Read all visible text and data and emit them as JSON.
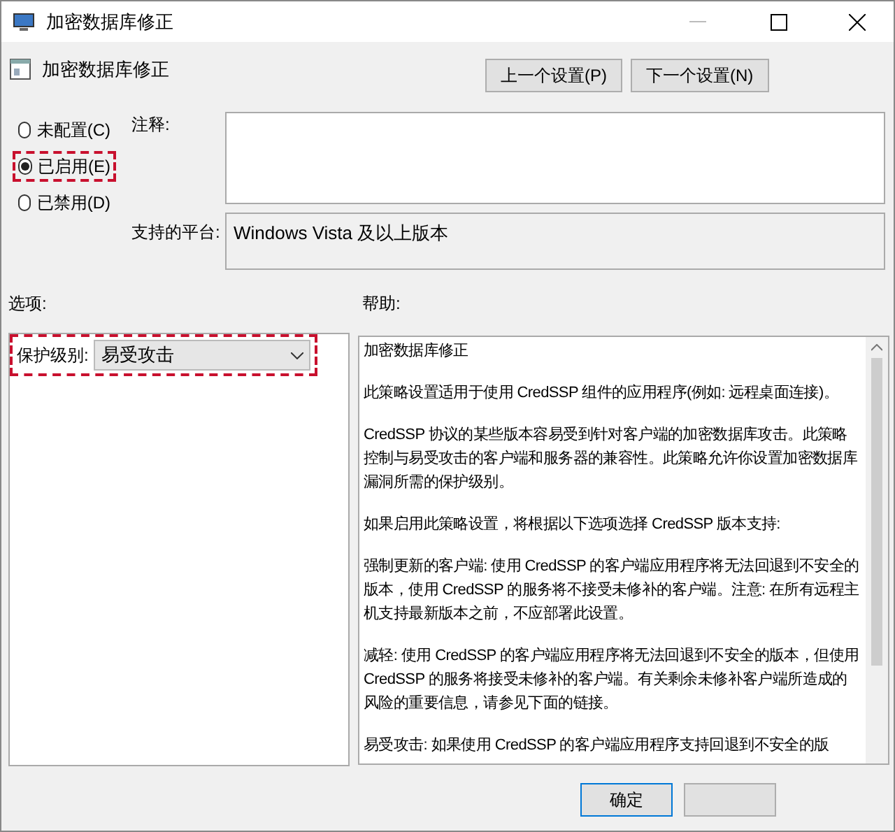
{
  "window": {
    "title": "加密数据库修正"
  },
  "header": {
    "title": "加密数据库修正",
    "buttons": [
      "上一个设置(P)",
      "下一个设置(N)"
    ]
  },
  "state_options": [
    {
      "label": "未配置(C)",
      "selected": false,
      "highlighted": false
    },
    {
      "label": "已启用(E)",
      "selected": true,
      "highlighted": true
    },
    {
      "label": "已禁用(D)",
      "selected": false,
      "highlighted": false
    }
  ],
  "comment": {
    "label": "注释:"
  },
  "platform": {
    "label": "支持的平台:",
    "value": "Windows Vista 及以上版本"
  },
  "options": {
    "heading": "选项:",
    "field_label": "保护级别:",
    "value": "易受攻击",
    "highlighted": true
  },
  "help": {
    "heading": "帮助:",
    "paragraphs": [
      "加密数据库修正",
      "此策略设置适用于使用 CredSSP 组件的应用程序(例如: 远程桌面连接)。",
      "CredSSP 协议的某些版本容易受到针对客户端的加密数据库攻击。此策略控制与易受攻击的客户端和服务器的兼容性。此策略允许你设置加密数据库漏洞所需的保护级别。",
      "如果启用此策略设置，将根据以下选项选择 CredSSP 版本支持:",
      "强制更新的客户端: 使用 CredSSP 的客户端应用程序将无法回退到不安全的版本，使用 CredSSP 的服务将不接受未修补的客户端。注意: 在所有远程主机支持最新版本之前，不应部署此设置。",
      "减轻: 使用 CredSSP 的客户端应用程序将无法回退到不安全的版本，但使用 CredSSP 的服务将接受未修补的客户端。有关剩余未修补客户端所造成的风险的重要信息，请参见下面的链接。",
      "易受攻击: 如果使用 CredSSP 的客户端应用程序支持回退到不安全的版"
    ]
  },
  "footer": {
    "buttons": [
      "确定"
    ]
  }
}
